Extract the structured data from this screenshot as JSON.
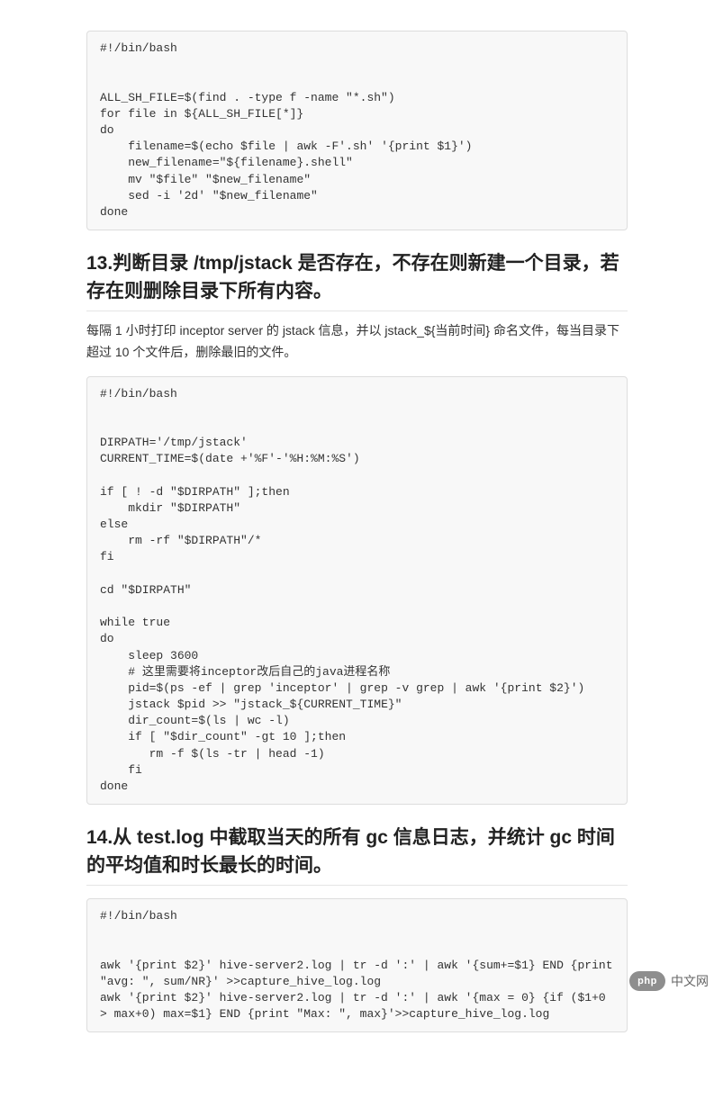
{
  "code_block_1": "#!/bin/bash\n\n\nALL_SH_FILE=$(find . -type f -name \"*.sh\")\nfor file in ${ALL_SH_FILE[*]}\ndo\n    filename=$(echo $file | awk -F'.sh' '{print $1}')\n    new_filename=\"${filename}.shell\"\n    mv \"$file\" \"$new_filename\"\n    sed -i '2d' \"$new_filename\"\ndone",
  "heading_13": "13.判断目录 /tmp/jstack 是否存在，不存在则新建一个目录，若存在则删除目录下所有内容。",
  "para_13": "每隔 1 小时打印 inceptor server 的 jstack 信息，并以 jstack_${当前时间} 命名文件，每当目录下超过 10 个文件后，删除最旧的文件。",
  "code_block_2": "#!/bin/bash\n\n\nDIRPATH='/tmp/jstack'\nCURRENT_TIME=$(date +'%F'-'%H:%M:%S')\n\nif [ ! -d \"$DIRPATH\" ];then\n    mkdir \"$DIRPATH\"\nelse\n    rm -rf \"$DIRPATH\"/*\nfi\n\ncd \"$DIRPATH\"\n\nwhile true\ndo\n    sleep 3600\n    # 这里需要将inceptor改后自己的java进程名称\n    pid=$(ps -ef | grep 'inceptor' | grep -v grep | awk '{print $2}')\n    jstack $pid >> \"jstack_${CURRENT_TIME}\"\n    dir_count=$(ls | wc -l)\n    if [ \"$dir_count\" -gt 10 ];then\n       rm -f $(ls -tr | head -1)\n    fi\ndone",
  "heading_14": "14.从 test.log 中截取当天的所有 gc 信息日志，并统计 gc 时间的平均值和时长最长的时间。",
  "code_block_3": "#!/bin/bash\n\n\nawk '{print $2}' hive-server2.log | tr -d ':' | awk '{sum+=$1} END {print \"avg: \", sum/NR}' >>capture_hive_log.log\nawk '{print $2}' hive-server2.log | tr -d ':' | awk '{max = 0} {if ($1+0 > max+0) max=$1} END {print \"Max: \", max}'>>capture_hive_log.log",
  "watermark": {
    "logo_text": "php",
    "label": "中文网"
  }
}
